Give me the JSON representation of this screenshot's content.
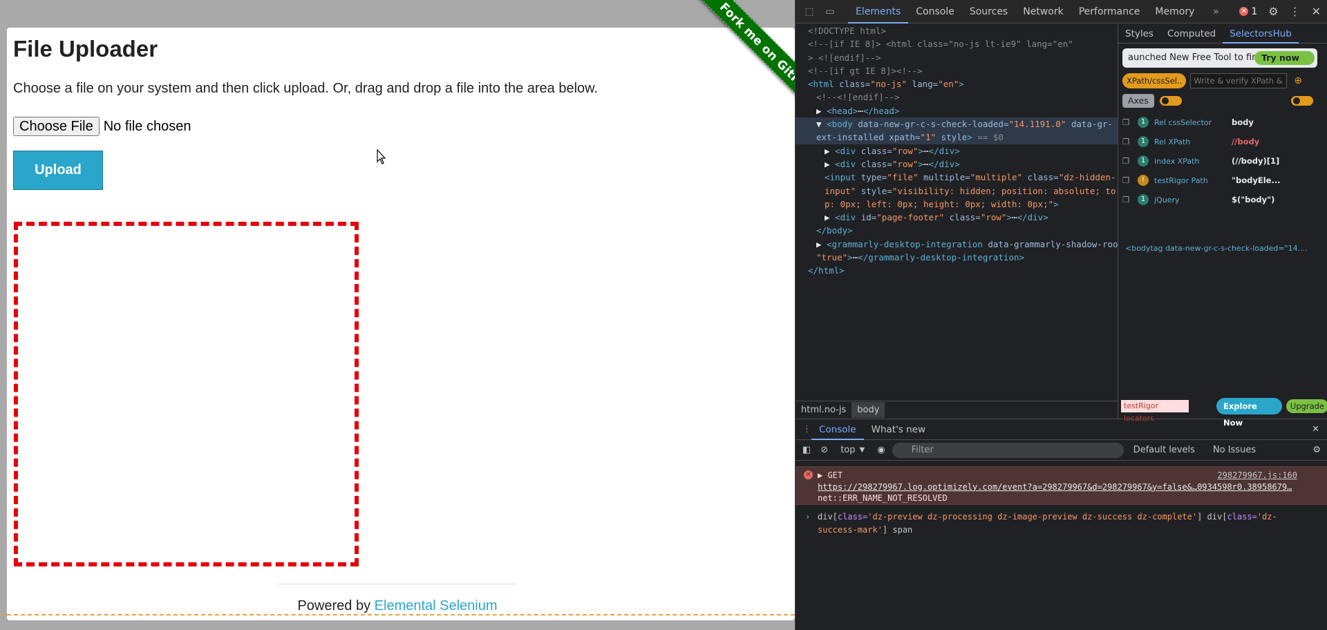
{
  "page": {
    "ribbon": "Fork me on GitHub",
    "title": "File Uploader",
    "instructions": "Choose a file on your system and then click upload. Or, drag and drop a file into the area below.",
    "choose_file_label": "Choose File",
    "no_file_text": "No file chosen",
    "upload_label": "Upload",
    "footer_prefix": "Powered by",
    "footer_link": "Elemental Selenium"
  },
  "devtools": {
    "tabs": [
      "Elements",
      "Console",
      "Sources",
      "Network",
      "Performance",
      "Memory"
    ],
    "active_tab": "Elements",
    "error_count": "1",
    "elements_lines": [
      {
        "indent": 0,
        "html": "<span class='cmt'>&lt;!DOCTYPE html&gt;</span>"
      },
      {
        "indent": 0,
        "html": "<span class='cmt'>&lt;!--[if IE 8]&gt;         &lt;html class=\"no-js lt-ie9\" lang=\"en\"</span>"
      },
      {
        "indent": 0,
        "html": "<span class='cmt'>&gt; &lt;![endif]--&gt;</span>"
      },
      {
        "indent": 0,
        "html": "<span class='cmt'>&lt;!--[if gt IE 8]&gt;&lt;!--&gt;</span>"
      },
      {
        "indent": 0,
        "html": "<span class='tag'>&lt;html</span> <span class='attr'>class=</span><span class='val'>\"no-js\"</span> <span class='attr'>lang=</span><span class='val'>\"en\"</span><span class='tag'>&gt;</span>"
      },
      {
        "indent": 1,
        "html": "<span class='cmt'>&lt;!--&lt;![endif]--&gt;</span>"
      },
      {
        "indent": 1,
        "html": "<span class='txt'>▶ </span><span class='tag'>&lt;head&gt;</span><span class='txt'>⋯</span><span class='tag'>&lt;/head&gt;</span>"
      },
      {
        "indent": 1,
        "sel": true,
        "html": "<span class='txt'>▼ </span><span class='tag'>&lt;body</span> <span class='attr'>data-new-gr-c-s-check-loaded=</span><span class='val'>\"14.1191.0\"</span> <span class='attr'>data-gr-</span>"
      },
      {
        "indent": 1,
        "sel": true,
        "html": "<span class='attr'>ext-installed xpath=</span><span class='val'>\"1\"</span> <span class='attr'>style</span><span class='tag'>&gt;</span> <span class='cmt'>== $0</span>"
      },
      {
        "indent": 2,
        "html": "<span class='txt'>▶ </span><span class='tag'>&lt;div</span> <span class='attr'>class=</span><span class='val'>\"row\"</span><span class='tag'>&gt;</span><span class='txt'>⋯</span><span class='tag'>&lt;/div&gt;</span>"
      },
      {
        "indent": 2,
        "html": "<span class='txt'>▶ </span><span class='tag'>&lt;div</span> <span class='attr'>class=</span><span class='val'>\"row\"</span><span class='tag'>&gt;</span><span class='txt'>⋯</span><span class='tag'>&lt;/div&gt;</span>"
      },
      {
        "indent": 2,
        "html": "<span class='tag'>&lt;input</span> <span class='attr'>type=</span><span class='val'>\"file\"</span> <span class='attr'>multiple=</span><span class='val'>\"multiple\"</span> <span class='attr'>class=</span><span class='val'>\"dz-hidden-</span>"
      },
      {
        "indent": 2,
        "html": "<span class='val'>input\"</span> <span class='attr'>style=</span><span class='val'>\"visibility: hidden; position: absolute; to</span>"
      },
      {
        "indent": 2,
        "html": "<span class='val'>p: 0px; left: 0px; height: 0px; width: 0px;\"</span><span class='tag'>&gt;</span>"
      },
      {
        "indent": 2,
        "html": "<span class='txt'>▶ </span><span class='tag'>&lt;div</span> <span class='attr'>id=</span><span class='val'>\"page-footer\"</span> <span class='attr'>class=</span><span class='val'>\"row\"</span><span class='tag'>&gt;</span><span class='txt'>⋯</span><span class='tag'>&lt;/div&gt;</span>"
      },
      {
        "indent": 1,
        "html": "<span class='tag'>&lt;/body&gt;</span>"
      },
      {
        "indent": 1,
        "html": "<span class='txt'>▶ </span><span class='tag'>&lt;grammarly-desktop-integration</span> <span class='attr'>data-grammarly-shadow-root=</span>"
      },
      {
        "indent": 1,
        "html": "<span class='val'>\"true\"</span><span class='tag'>&gt;</span><span class='txt'>⋯</span><span class='tag'>&lt;/grammarly-desktop-integration&gt;</span>"
      },
      {
        "indent": 0,
        "html": "<span class='tag'>&lt;/html&gt;</span>"
      }
    ],
    "breadcrumbs": [
      "html.no-js",
      "body"
    ],
    "sidebar_tabs": [
      "Styles",
      "Computed",
      "SelectorsHub"
    ],
    "sidebar_active": "SelectorsHub",
    "banner_text": "aunched New Free Tool to fin",
    "try_now": "Try now",
    "xpath_pill": "XPath/cssSel..",
    "xpath_placeholder": "Write & verify XPath &",
    "axes_label": "Axes",
    "locators": [
      {
        "count": "1",
        "name": "Rel cssSelector",
        "value": "body",
        "warn": false,
        "red": false
      },
      {
        "count": "1",
        "name": "Rel XPath",
        "value": "//body",
        "warn": false,
        "red": true
      },
      {
        "count": "1",
        "name": "index XPath",
        "value": "(//body)[1]",
        "warn": false,
        "red": false
      },
      {
        "count": "!",
        "name": "testRigor Path",
        "value": "\"bodyEle...",
        "warn": true,
        "red": false
      },
      {
        "count": "1",
        "name": "jQuery",
        "value": "$(\"body\")",
        "warn": false,
        "red": false
      }
    ],
    "bodytag": "<bodytag data-new-gr-c-s-check-loaded=\"14....",
    "testrigor_label": "testRigor locators",
    "explore_now": "Explore Now",
    "upgrade": "Upgrade",
    "drawer_tabs": [
      "Console",
      "What's new"
    ],
    "context": "top",
    "filter_placeholder": "Filter",
    "levels": "Default levels",
    "issues": "No Issues",
    "error": {
      "method": "GET",
      "source": "298279967.js:160",
      "url": "https://298279967.log.optimizely.com/event?a=298279967&d=298279967&y=false&…0934598r0.38958679…",
      "message": "net::ERR_NAME_NOT_RESOLVED"
    },
    "command": {
      "line1_a": "div[",
      "line1_b": "class=",
      "line1_c": "'dz-preview dz-processing dz-image-preview dz-success dz-complete'",
      "line1_d": "] div[",
      "line1_e": "class=",
      "line1_f": "'dz-",
      "line2_a": "success-mark'",
      "line2_b": "] span"
    }
  }
}
